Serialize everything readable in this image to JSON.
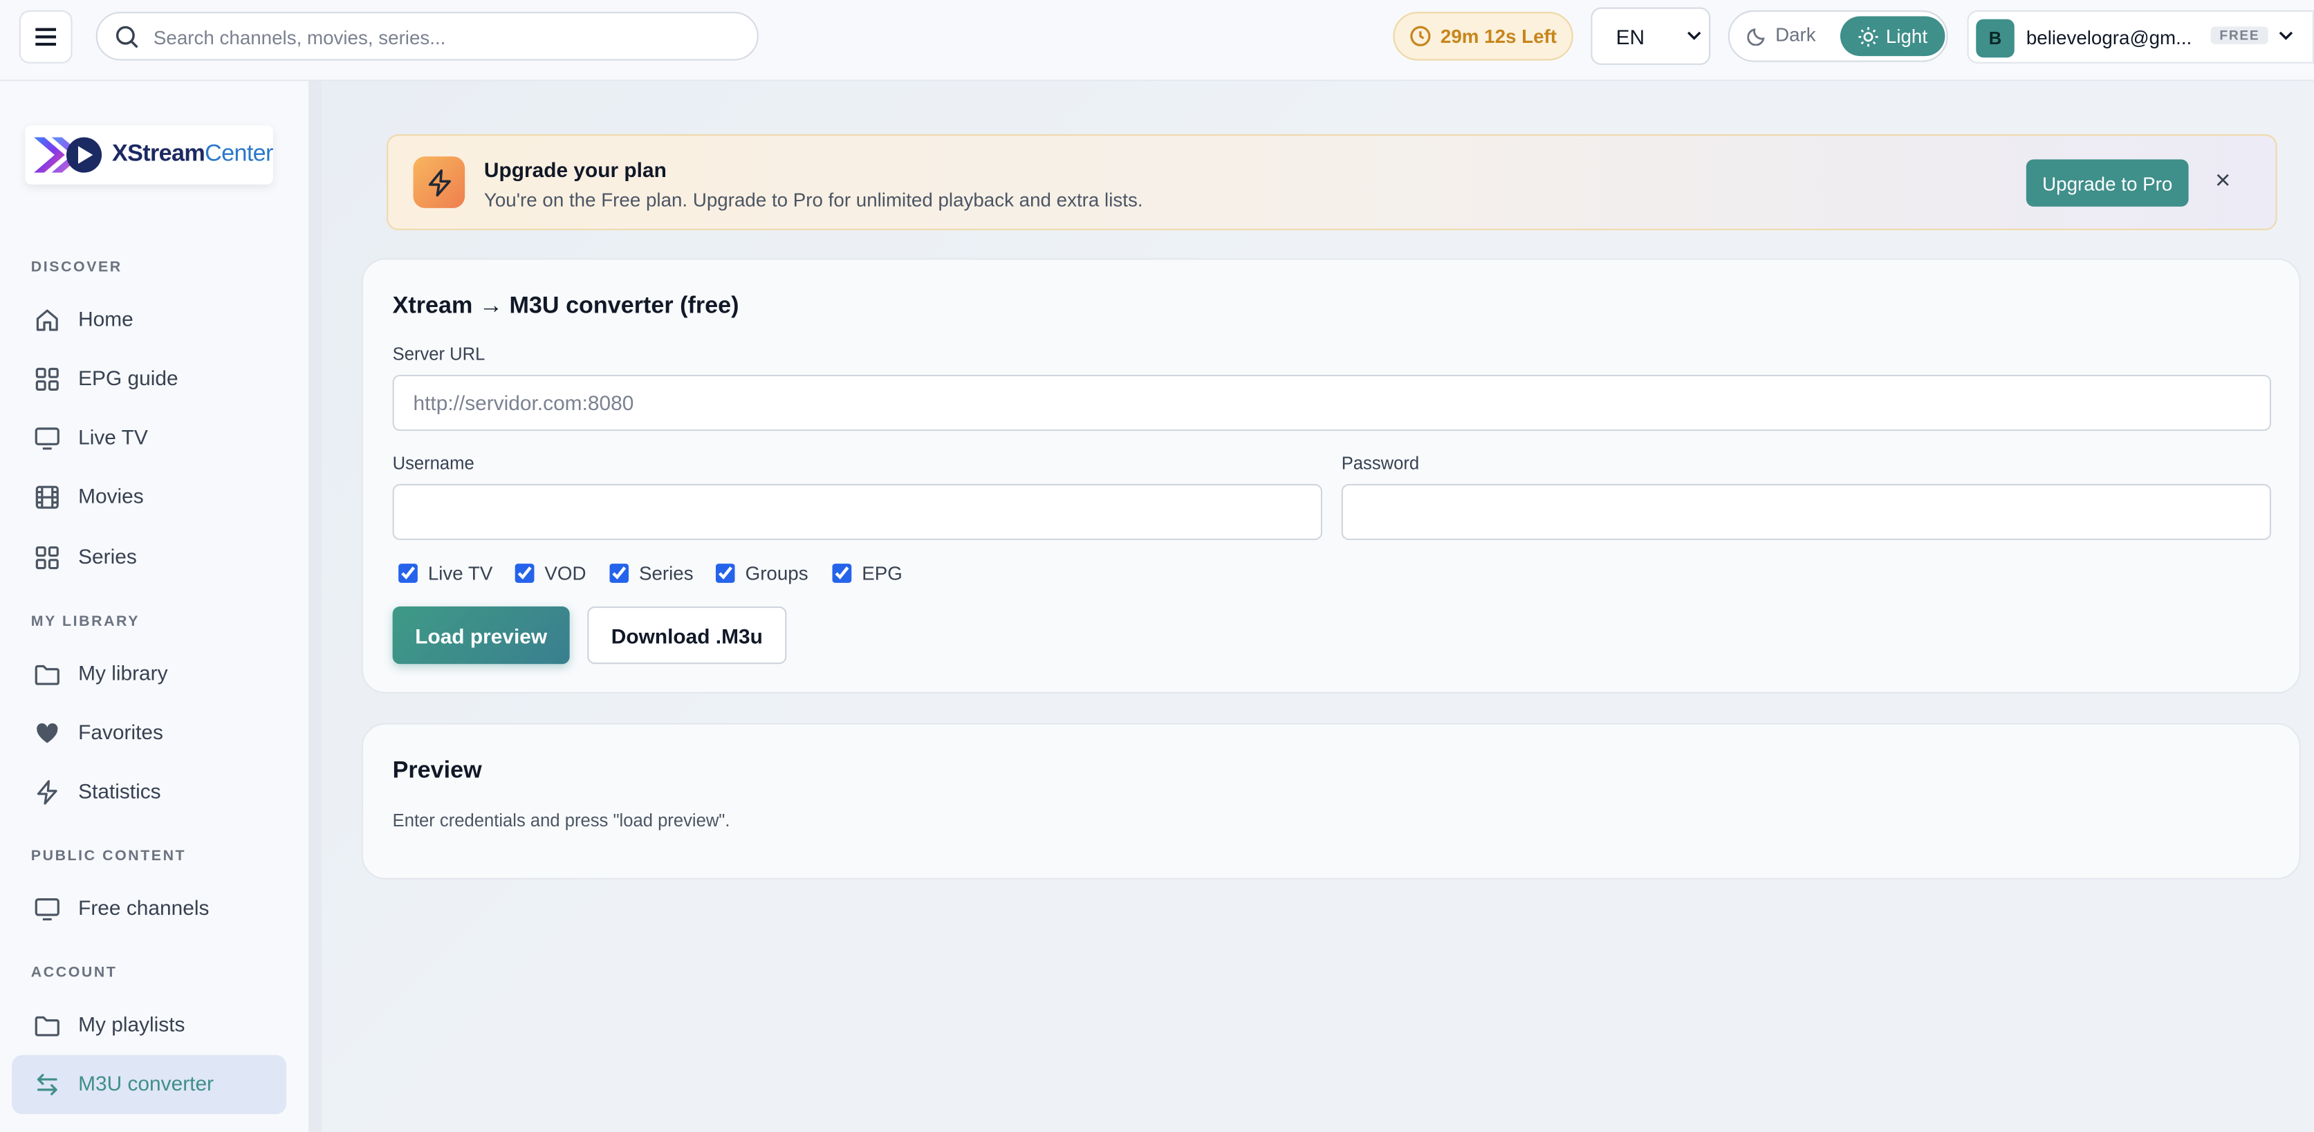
{
  "colors": {
    "accent": "#3f8f8a",
    "warning": "#c7851c",
    "active_bg": "#dfe6f5"
  },
  "header": {
    "search_placeholder": "Search channels, movies, series...",
    "timer": "29m 12s Left",
    "language": "EN",
    "theme_dark": "Dark",
    "theme_light": "Light",
    "user_initial": "B",
    "user_email": "believelogra@gm...",
    "user_plan": "FREE"
  },
  "sidebar": {
    "logo_text_main": "XStream",
    "logo_text_accent": "Center",
    "sections": {
      "discover": "DISCOVER",
      "library": "MY LIBRARY",
      "public": "PUBLIC CONTENT",
      "account": "ACCOUNT"
    },
    "items": [
      {
        "label": "Home",
        "icon": "home-icon"
      },
      {
        "label": "EPG guide",
        "icon": "grid-icon"
      },
      {
        "label": "Live TV",
        "icon": "tv-icon"
      },
      {
        "label": "Movies",
        "icon": "film-icon"
      },
      {
        "label": "Series",
        "icon": "grid-icon"
      },
      {
        "label": "My library",
        "icon": "folder-icon"
      },
      {
        "label": "Favorites",
        "icon": "heart-icon"
      },
      {
        "label": "Statistics",
        "icon": "bolt-icon"
      },
      {
        "label": "Free channels",
        "icon": "tv-icon"
      },
      {
        "label": "My playlists",
        "icon": "folder-icon"
      },
      {
        "label": "M3U converter",
        "icon": "swap-icon",
        "active": true
      }
    ]
  },
  "banner": {
    "title": "Upgrade your plan",
    "subtitle": "You're on the Free plan. Upgrade to Pro for unlimited playback and extra lists.",
    "cta": "Upgrade to Pro",
    "close": "×"
  },
  "converter": {
    "title": "Xtream → M3U converter (free)",
    "server_label": "Server URL",
    "server_placeholder": "http://servidor.com:8080",
    "username_label": "Username",
    "password_label": "Password",
    "options": [
      "Live TV",
      "VOD",
      "Series",
      "Groups",
      "EPG"
    ],
    "load_button": "Load preview",
    "download_button": "Download .M3u"
  },
  "preview": {
    "title": "Preview",
    "text": "Enter credentials and press \"load preview\"."
  }
}
